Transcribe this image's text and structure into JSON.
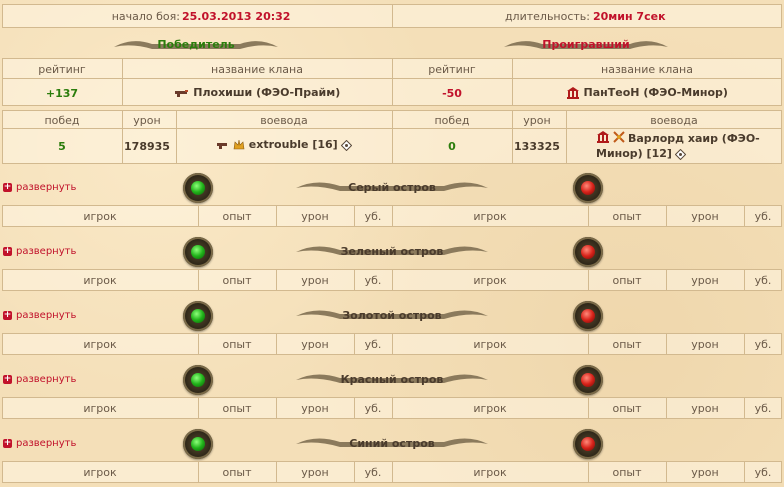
{
  "header": {
    "start_label": "начало боя:",
    "start_value": "25.03.2013 20:32",
    "duration_label": "длительность:",
    "duration_value": "20мин 7сек"
  },
  "winner": {
    "title": "Победитель",
    "col_rating": "рейтинг",
    "col_clan": "название клана",
    "rating": "+137",
    "clan": "Плохиши (ФЭО-Прайм)",
    "col_wins": "побед",
    "col_damage": "урон",
    "col_leader": "воевода",
    "wins": "5",
    "damage": "178935",
    "leader": "extrouble [16]"
  },
  "loser": {
    "title": "Проигравший",
    "col_rating": "рейтинг",
    "col_clan": "название клана",
    "rating": "-50",
    "clan": "ПанТеоН (ФЭО-Минор)",
    "col_wins": "побед",
    "col_damage": "урон",
    "col_leader": "воевода",
    "wins": "0",
    "damage": "133325",
    "leader": "Варлорд хаир (ФЭО-Минор) [12]"
  },
  "island_columns": [
    "игрок",
    "опыт",
    "урон",
    "уб."
  ],
  "expand_label": "развернуть",
  "islands": [
    {
      "name": "Серый остров"
    },
    {
      "name": "Зеленый остров"
    },
    {
      "name": "Золотой остров"
    },
    {
      "name": "Красный остров"
    },
    {
      "name": "Синий остров"
    }
  ],
  "colors": {
    "green": "#2b7d0c",
    "red": "#c1122b"
  }
}
